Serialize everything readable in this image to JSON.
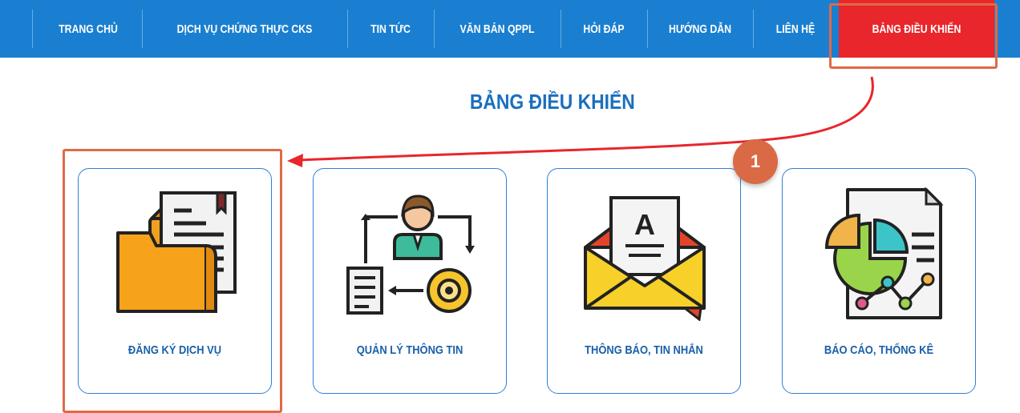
{
  "nav": {
    "items": [
      {
        "label": "TRANG CHỦ"
      },
      {
        "label": "DỊCH VỤ CHỨNG THỰC CKS"
      },
      {
        "label": "TIN TỨC"
      },
      {
        "label": "VĂN BẢN QPPL"
      },
      {
        "label": "HỎI ĐÁP"
      },
      {
        "label": "HƯỚNG DẪN"
      },
      {
        "label": "LIÊN HỆ"
      },
      {
        "label": "BẢNG ĐIỀU KHIỂN"
      }
    ],
    "active_color": "#e8262b",
    "bar_color": "#1a7fd0"
  },
  "page_title": "BẢNG ĐIỀU KHIỂN",
  "step_badge": "1",
  "cards": [
    {
      "label": "ĐĂNG KÝ DỊCH VỤ",
      "icon": "folder-document-icon"
    },
    {
      "label": "QUẢN LÝ THÔNG TIN",
      "icon": "user-management-icon"
    },
    {
      "label": "THÔNG BÁO, TIN NHẮN",
      "icon": "envelope-letter-icon"
    },
    {
      "label": "BÁO CÁO, THỐNG KÊ",
      "icon": "report-chart-icon"
    }
  ],
  "annotation_color": "#e06a45"
}
